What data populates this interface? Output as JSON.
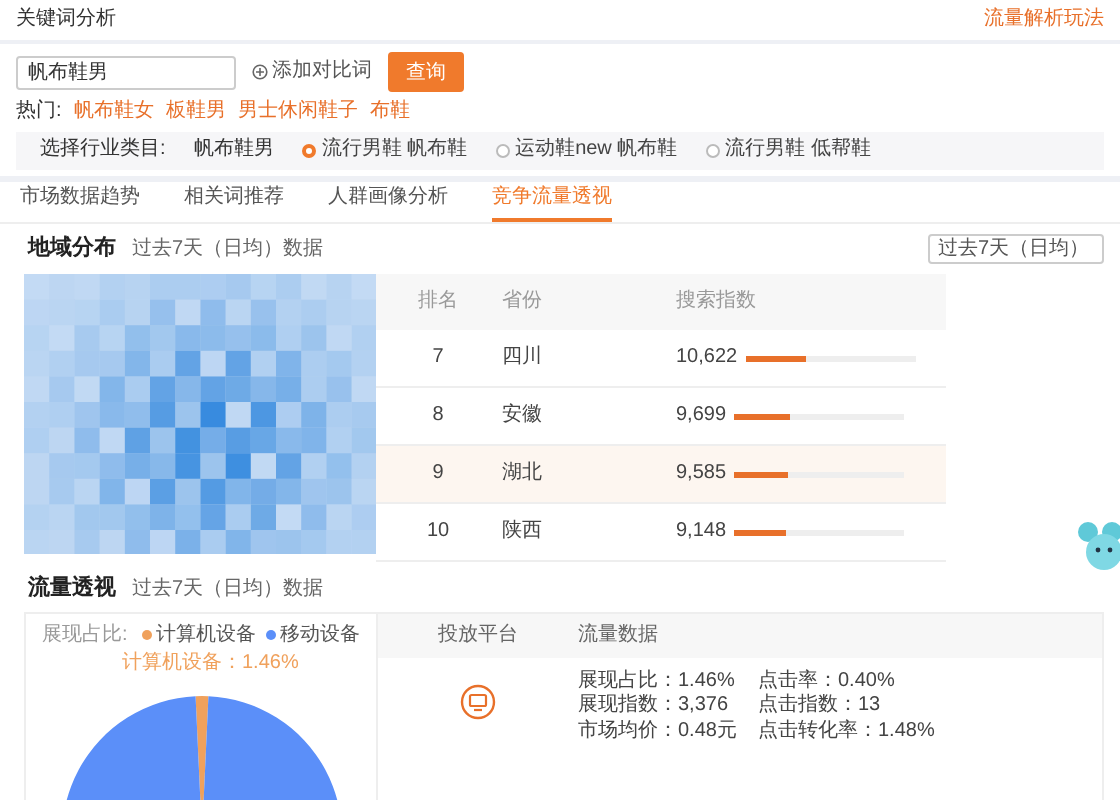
{
  "header": {
    "title": "关键词分析",
    "link": "流量解析玩法"
  },
  "search": {
    "value": "帆布鞋男",
    "add_compare": "添加对比词",
    "button": "查询"
  },
  "hot": {
    "label": "热门:",
    "items": [
      "帆布鞋女",
      "板鞋男",
      "男士休闲鞋子",
      "布鞋"
    ]
  },
  "category": {
    "label": "选择行业类目:",
    "keyword": "帆布鞋男",
    "options": [
      {
        "label": "流行男鞋 帆布鞋",
        "selected": true
      },
      {
        "label": "运动鞋new 帆布鞋",
        "selected": false
      },
      {
        "label": "流行男鞋 低帮鞋",
        "selected": false
      }
    ]
  },
  "tabs": [
    {
      "label": "市场数据趋势",
      "selected": false
    },
    {
      "label": "相关词推荐",
      "selected": false
    },
    {
      "label": "人群画像分析",
      "selected": false
    },
    {
      "label": "竞争流量透视",
      "selected": true
    }
  ],
  "region": {
    "title": "地域分布",
    "subtitle": "过去7天（日均）数据",
    "period": "过去7天（日均）",
    "columns": [
      "排名",
      "省份",
      "搜索指数"
    ],
    "rows": [
      {
        "rank": "7",
        "province": "四川",
        "index": "10,622",
        "level": 0.36,
        "selected": false
      },
      {
        "rank": "8",
        "province": "安徽",
        "index": "9,699",
        "level": 0.33,
        "selected": false
      },
      {
        "rank": "9",
        "province": "湖北",
        "index": "9,585",
        "level": 0.32,
        "selected": true
      },
      {
        "rank": "10",
        "province": "陕西",
        "index": "9,148",
        "level": 0.31,
        "selected": false
      }
    ]
  },
  "traffic": {
    "title": "流量透视",
    "subtitle": "过去7天（日均）数据",
    "chart_data": {
      "type": "pie",
      "title": "展现占比:",
      "legend": "top-right",
      "categories": [
        "计算机设备",
        "移动设备"
      ],
      "values": [
        1.46,
        98.54
      ],
      "colors": [
        "#f0a15c",
        "#5b8ff9"
      ],
      "annotations": [
        {
          "text": "计算机设备：1.46%"
        }
      ]
    },
    "columns": [
      "投放平台",
      "流量数据"
    ],
    "metrics_left": [
      "展现占比：1.46%",
      "展现指数：3,376",
      "市场均价：0.48元"
    ],
    "metrics_right": [
      "点击率：0.40%",
      "点击指数：13",
      "点击转化率：1.48%"
    ]
  }
}
